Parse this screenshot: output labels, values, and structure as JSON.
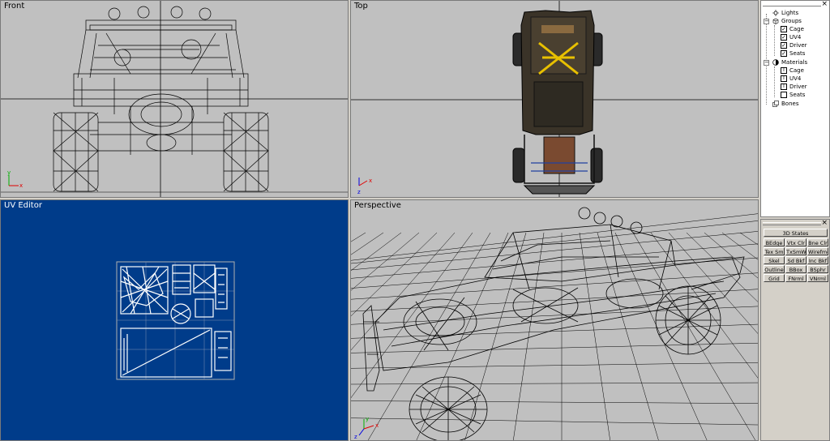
{
  "viewports": {
    "front": {
      "label": "Front"
    },
    "top": {
      "label": "Top"
    },
    "uv": {
      "label": "UV Editor"
    },
    "perspective": {
      "label": "Perspective"
    }
  },
  "tree": {
    "close": "×",
    "lights": "Lights",
    "groups": "Groups",
    "group_items": [
      "Cage",
      "UV4",
      "Driver",
      "Seats"
    ],
    "materials": "Materials",
    "material_items": [
      "Cage",
      "UV4",
      "Driver",
      "Seats"
    ],
    "bones": "Bones"
  },
  "states": {
    "close": "×",
    "title": "3D States",
    "buttons": [
      [
        "BEdge",
        "Vtx Clr",
        "Bne Clr"
      ],
      [
        "Tex Sm",
        "TxSmWr",
        "Wirefme"
      ],
      [
        "Skel",
        "Sd Bkf",
        "Inc Bkf"
      ],
      [
        "Outline",
        "BBox",
        "BSphr"
      ],
      [
        "Grid",
        "FNrml",
        "VNrml"
      ]
    ]
  },
  "axes": {
    "front": [
      "y",
      "x"
    ],
    "top": [
      "x",
      "z"
    ],
    "perspective": [
      "y",
      "x",
      "z"
    ]
  },
  "colors": {
    "viewport_bg": "#c0c0c0",
    "uv_bg": "#003c8a",
    "wire": "#000000",
    "axis_x": "#e00000",
    "axis_y": "#00b000",
    "axis_z": "#0000e0"
  }
}
